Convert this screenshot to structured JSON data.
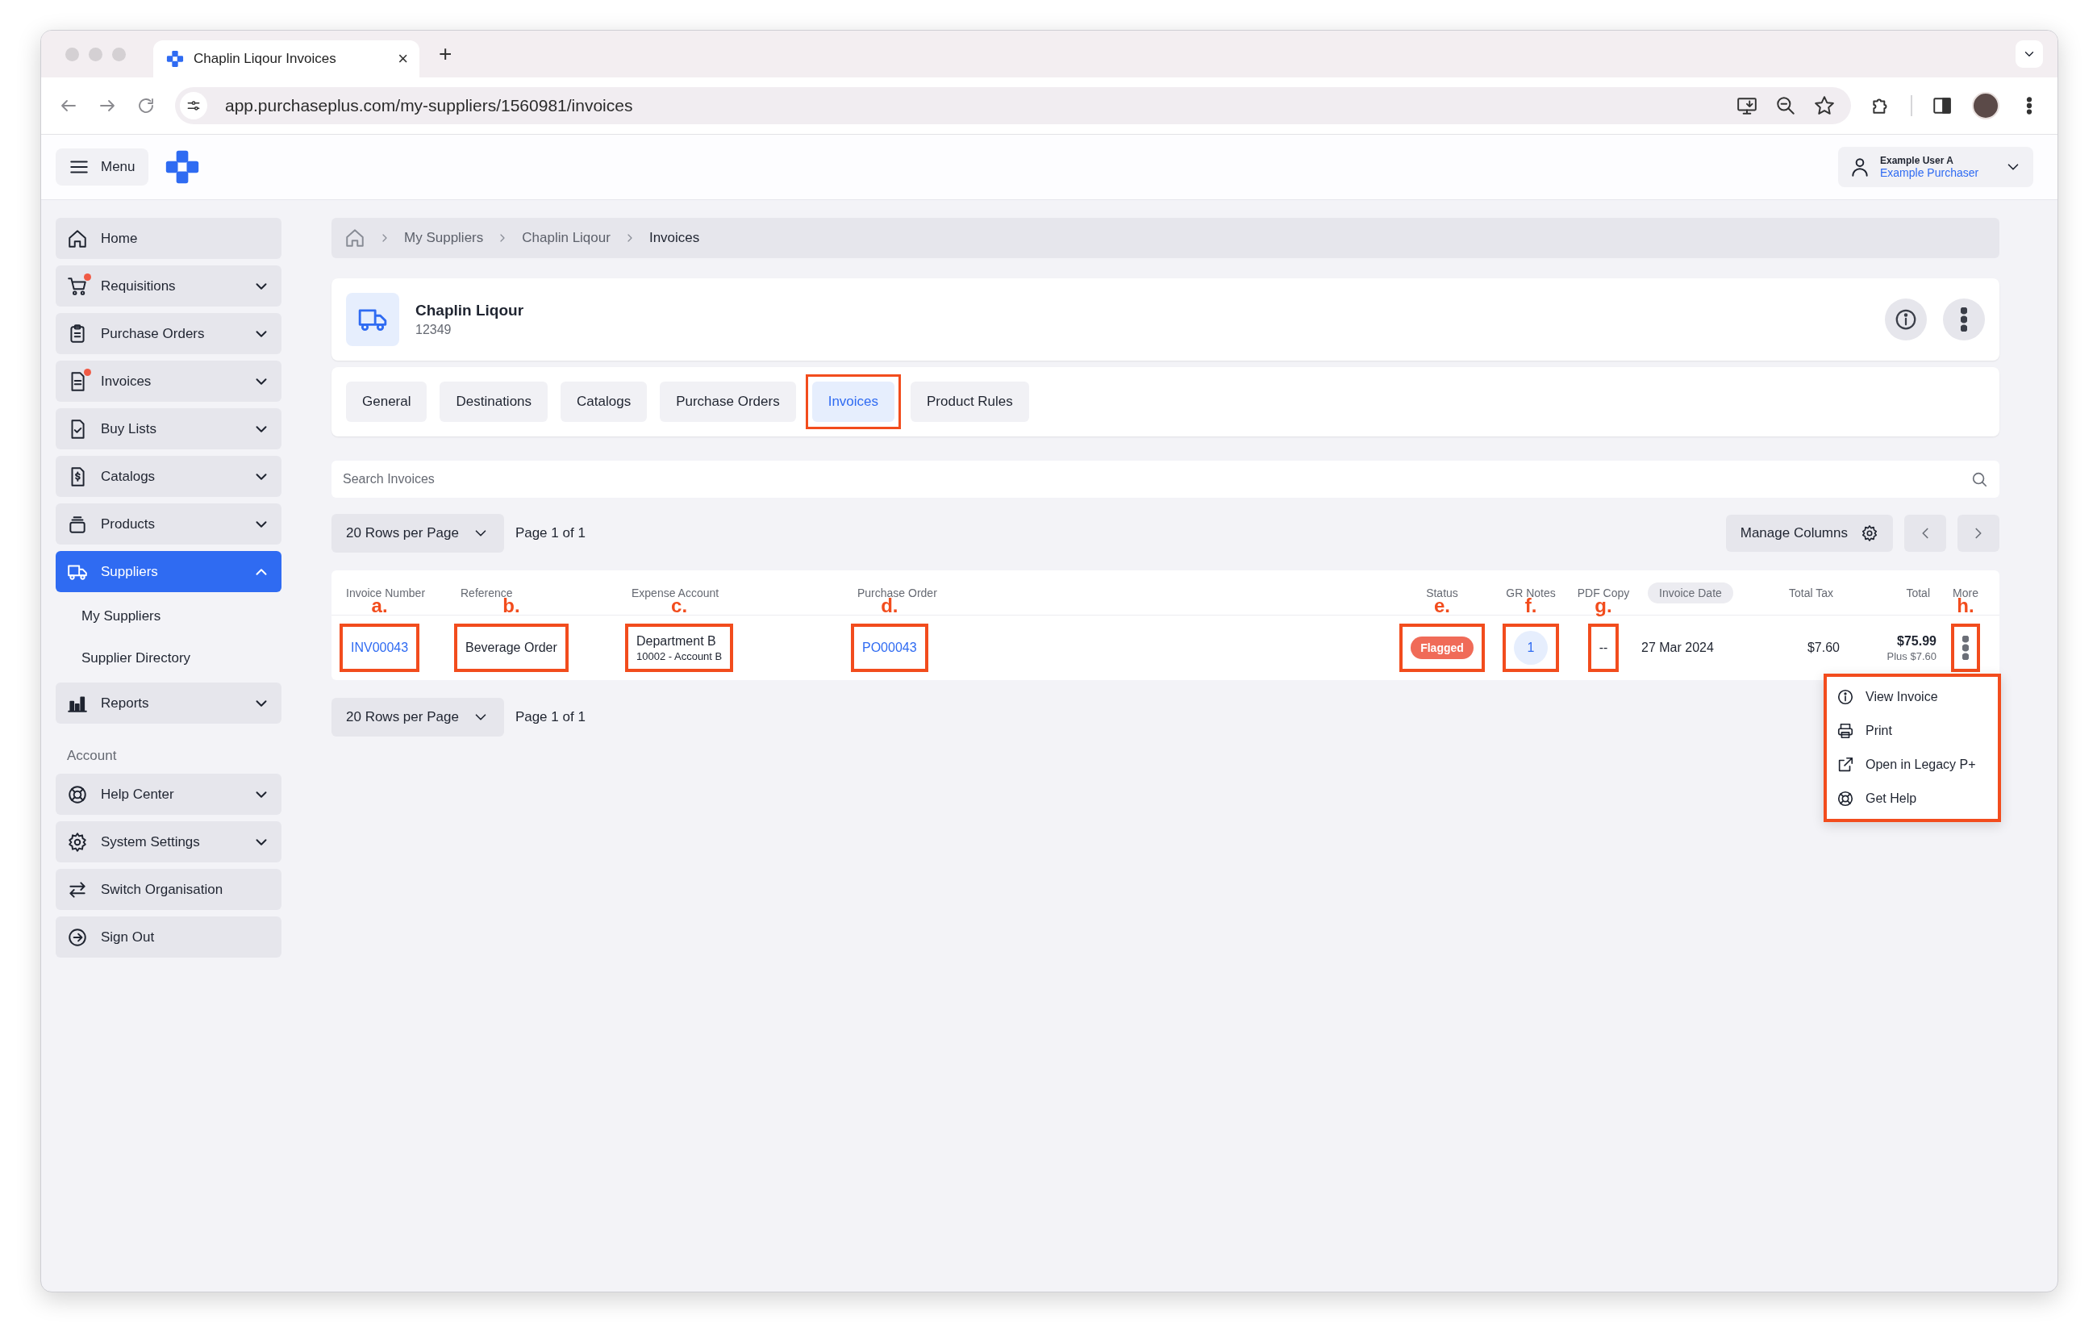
{
  "browser": {
    "tab_title": "Chaplin Liqour Invoices",
    "tab_close": "×",
    "new_tab": "+",
    "url": "app.purchaseplus.com/my-suppliers/1560981/invoices"
  },
  "header": {
    "menu_label": "Menu",
    "user_name": "Example User A",
    "user_role": "Example Purchaser"
  },
  "sidebar": {
    "items": [
      {
        "label": "Home",
        "kind": "link",
        "selected": false,
        "badge": false
      },
      {
        "label": "Requisitions",
        "kind": "group",
        "expanded": false,
        "selected": false,
        "badge": true
      },
      {
        "label": "Purchase Orders",
        "kind": "group",
        "expanded": false,
        "selected": false,
        "badge": false
      },
      {
        "label": "Invoices",
        "kind": "group",
        "expanded": false,
        "selected": false,
        "badge": true
      },
      {
        "label": "Buy Lists",
        "kind": "group",
        "expanded": false,
        "selected": false,
        "badge": false
      },
      {
        "label": "Catalogs",
        "kind": "group",
        "expanded": false,
        "selected": false,
        "badge": false
      },
      {
        "label": "Products",
        "kind": "group",
        "expanded": false,
        "selected": false,
        "badge": false
      },
      {
        "label": "Suppliers",
        "kind": "group",
        "expanded": true,
        "selected": true,
        "badge": false,
        "children": [
          {
            "label": "My Suppliers",
            "selected": false
          },
          {
            "label": "Supplier Directory",
            "selected": false
          }
        ]
      },
      {
        "label": "Reports",
        "kind": "group",
        "expanded": false,
        "selected": false,
        "badge": false
      }
    ],
    "account_heading": "Account",
    "account_items": [
      {
        "label": "Help Center",
        "kind": "group",
        "expanded": false,
        "selected": false
      },
      {
        "label": "System Settings",
        "kind": "group",
        "expanded": false,
        "selected": false
      },
      {
        "label": "Switch Organisation",
        "kind": "link",
        "selected": false
      },
      {
        "label": "Sign Out",
        "kind": "link",
        "selected": false
      }
    ]
  },
  "breadcrumb": [
    "My Suppliers",
    "Chaplin Liqour",
    "Invoices"
  ],
  "supplier": {
    "name": "Chaplin Liqour",
    "code": "12349"
  },
  "tabs": [
    {
      "label": "General",
      "selected": false,
      "highlighted": false
    },
    {
      "label": "Destinations",
      "selected": false,
      "highlighted": false
    },
    {
      "label": "Catalogs",
      "selected": false,
      "highlighted": false
    },
    {
      "label": "Purchase Orders",
      "selected": false,
      "highlighted": false
    },
    {
      "label": "Invoices",
      "selected": true,
      "highlighted": true
    },
    {
      "label": "Product Rules",
      "selected": false,
      "highlighted": false
    }
  ],
  "search": {
    "placeholder": "Search Invoices"
  },
  "pagination_top": {
    "rows_per_page": "20 Rows per Page",
    "page": "Page 1 of 1",
    "manage_columns": "Manage Columns"
  },
  "table": {
    "columns": [
      {
        "label": "Invoice Number",
        "sorted": false
      },
      {
        "label": "Reference",
        "sorted": false
      },
      {
        "label": "Expense Account",
        "sorted": false
      },
      {
        "label": "Purchase Order",
        "sorted": false
      },
      {
        "label": "Status",
        "sorted": false
      },
      {
        "label": "GR Notes",
        "sorted": false
      },
      {
        "label": "PDF Copy",
        "sorted": false
      },
      {
        "label": "Invoice Date",
        "sorted": true
      },
      {
        "label": "Total Tax",
        "sorted": false
      },
      {
        "label": "Total",
        "sorted": false
      },
      {
        "label": "More",
        "sorted": false
      }
    ],
    "rows": [
      {
        "cells": [
          {
            "kind": "link",
            "text": "INV00043",
            "callout": "a."
          },
          {
            "kind": "text",
            "text": "Beverage Order",
            "callout": "b."
          },
          {
            "kind": "two_line",
            "text": "Department B",
            "subtext": "10002 - Account B",
            "callout": "c."
          },
          {
            "kind": "link",
            "text": "PO00043",
            "callout": "d."
          },
          {
            "kind": "status",
            "text": "Flagged",
            "callout": "e."
          },
          {
            "kind": "count",
            "text": "1",
            "callout": "f."
          },
          {
            "kind": "text",
            "text": "--",
            "callout": "g."
          },
          {
            "kind": "text",
            "text": "27 Mar 2024"
          },
          {
            "kind": "text",
            "text": "$7.60"
          },
          {
            "kind": "total",
            "text": "$75.99",
            "subtext": "Plus $7.60"
          },
          {
            "kind": "more",
            "callout": "h."
          }
        ]
      }
    ]
  },
  "row_menu": {
    "highlighted": true,
    "items": [
      {
        "label": "View Invoice"
      },
      {
        "label": "Print"
      },
      {
        "label": "Open in Legacy P+"
      },
      {
        "label": "Get Help"
      }
    ]
  },
  "pagination_bottom": {
    "rows_per_page": "20 Rows per Page",
    "page": "Page 1 of 1"
  }
}
